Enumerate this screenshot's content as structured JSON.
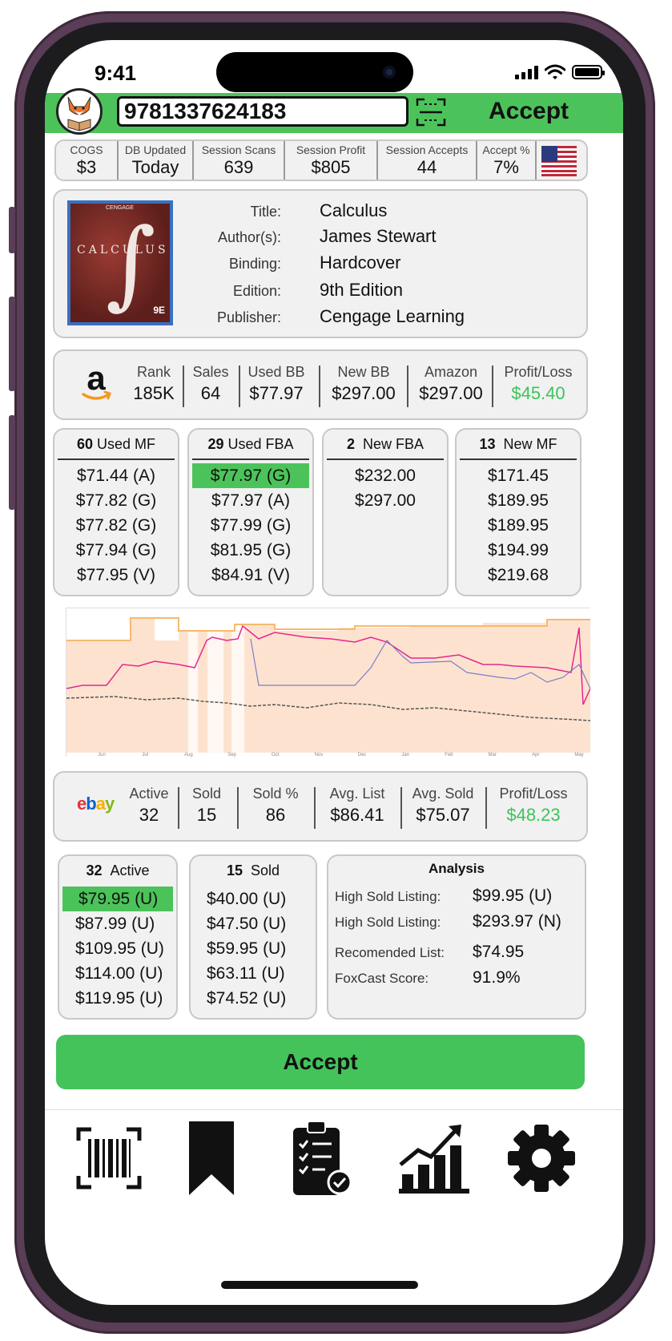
{
  "status": {
    "time": "9:41"
  },
  "header": {
    "isbn_value": "9781337624183",
    "accept_label": "Accept"
  },
  "stats": [
    {
      "label": "COGS",
      "value": "$3"
    },
    {
      "label": "DB Updated",
      "value": "Today"
    },
    {
      "label": "Session Scans",
      "value": "639"
    },
    {
      "label": "Session Profit",
      "value": "$805"
    },
    {
      "label": "Session Accepts",
      "value": "44"
    },
    {
      "label": "Accept %",
      "value": "7%"
    }
  ],
  "book": {
    "cover_text": "CALCULUS",
    "cover_edition": "9E",
    "cover_publisher": "CENGAGE",
    "details": [
      {
        "key": "Title:",
        "value": "Calculus"
      },
      {
        "key": "Author(s):",
        "value": "James Stewart"
      },
      {
        "key": "Binding:",
        "value": "Hardcover"
      },
      {
        "key": "Edition:",
        "value": "9th Edition"
      },
      {
        "key": "Publisher:",
        "value": "Cengage Learning"
      }
    ]
  },
  "amazon": {
    "logo_text": "a",
    "columns": [
      {
        "label": "Rank",
        "value": "185K"
      },
      {
        "label": "Sales",
        "value": "64"
      },
      {
        "label": "Used BB",
        "value": "$77.97"
      },
      {
        "label": "New BB",
        "value": "$297.00"
      },
      {
        "label": "Amazon",
        "value": "$297.00"
      },
      {
        "label": "Profit/Loss",
        "value": "$45.40"
      }
    ],
    "profit_color": "#3cc45a"
  },
  "offers": [
    {
      "count": "60",
      "label": "Used MF",
      "prices": [
        "$71.44 (A)",
        "$77.82 (G)",
        "$77.82 (G)",
        "$77.94 (G)",
        "$77.95 (V)"
      ],
      "highlight": -1
    },
    {
      "count": "29",
      "label": "Used FBA",
      "prices": [
        "$77.97 (G)",
        "$77.97 (A)",
        "$77.99 (G)",
        "$81.95 (G)",
        "$84.91 (V)"
      ],
      "highlight": 0
    },
    {
      "count": "2",
      "label": "New FBA",
      "prices": [
        "$232.00",
        "$297.00"
      ],
      "highlight": -1
    },
    {
      "count": "13",
      "label": "New MF",
      "prices": [
        "$171.45",
        "$189.95",
        "$189.95",
        "$194.99",
        "$219.68"
      ],
      "highlight": -1
    }
  ],
  "chart_data": {
    "type": "area",
    "x_ticks": [
      "Jun",
      "Jul",
      "Aug",
      "Sep",
      "Oct",
      "Nov",
      "Dec",
      "Jan",
      "Feb",
      "Mar",
      "Apr",
      "May"
    ],
    "colors": {
      "area": "#fde3cf",
      "amazon": "#f7b96e",
      "new": "#e6268f",
      "used": "#7a7fc7",
      "rank": "#555555"
    }
  },
  "ebay": {
    "logo_letters": [
      "e",
      "b",
      "a",
      "y"
    ],
    "logo_colors": [
      "#e53238",
      "#0064d2",
      "#f5af02",
      "#86b817"
    ],
    "columns": [
      {
        "label": "Active",
        "value": "32"
      },
      {
        "label": "Sold",
        "value": "15"
      },
      {
        "label": "Sold %",
        "value": "86"
      },
      {
        "label": "Avg. List",
        "value": "$86.41"
      },
      {
        "label": "Avg. Sold",
        "value": "$75.07"
      },
      {
        "label": "Profit/Loss",
        "value": "$48.23"
      }
    ]
  },
  "ebay_lists": [
    {
      "count": "32",
      "label": "Active",
      "prices": [
        "$79.95 (U)",
        "$87.99 (U)",
        "$109.95 (U)",
        "$114.00 (U)",
        "$119.95  (U)"
      ],
      "highlight": 0
    },
    {
      "count": "15",
      "label": "Sold",
      "prices": [
        "$40.00 (U)",
        "$47.50 (U)",
        "$59.95 (U)",
        "$63.11 (U)",
        "$74.52 (U)"
      ],
      "highlight": -1
    }
  ],
  "analysis": {
    "title": "Analysis",
    "rows": [
      {
        "key": "High Sold Listing:",
        "value": "$99.95 (U)"
      },
      {
        "key": "High Sold Listing:",
        "value": "$293.97 (N)"
      },
      {
        "key": "Recomended List:",
        "value": "$74.95"
      },
      {
        "key": "FoxCast Score:",
        "value": "91.9%"
      }
    ]
  },
  "accept_button": {
    "label": "Accept"
  },
  "tabbar": [
    {
      "name": "barcode-scan-icon"
    },
    {
      "name": "bookmark-icon"
    },
    {
      "name": "clipboard-checklist-icon"
    },
    {
      "name": "analytics-chart-icon"
    },
    {
      "name": "settings-gear-icon"
    }
  ]
}
